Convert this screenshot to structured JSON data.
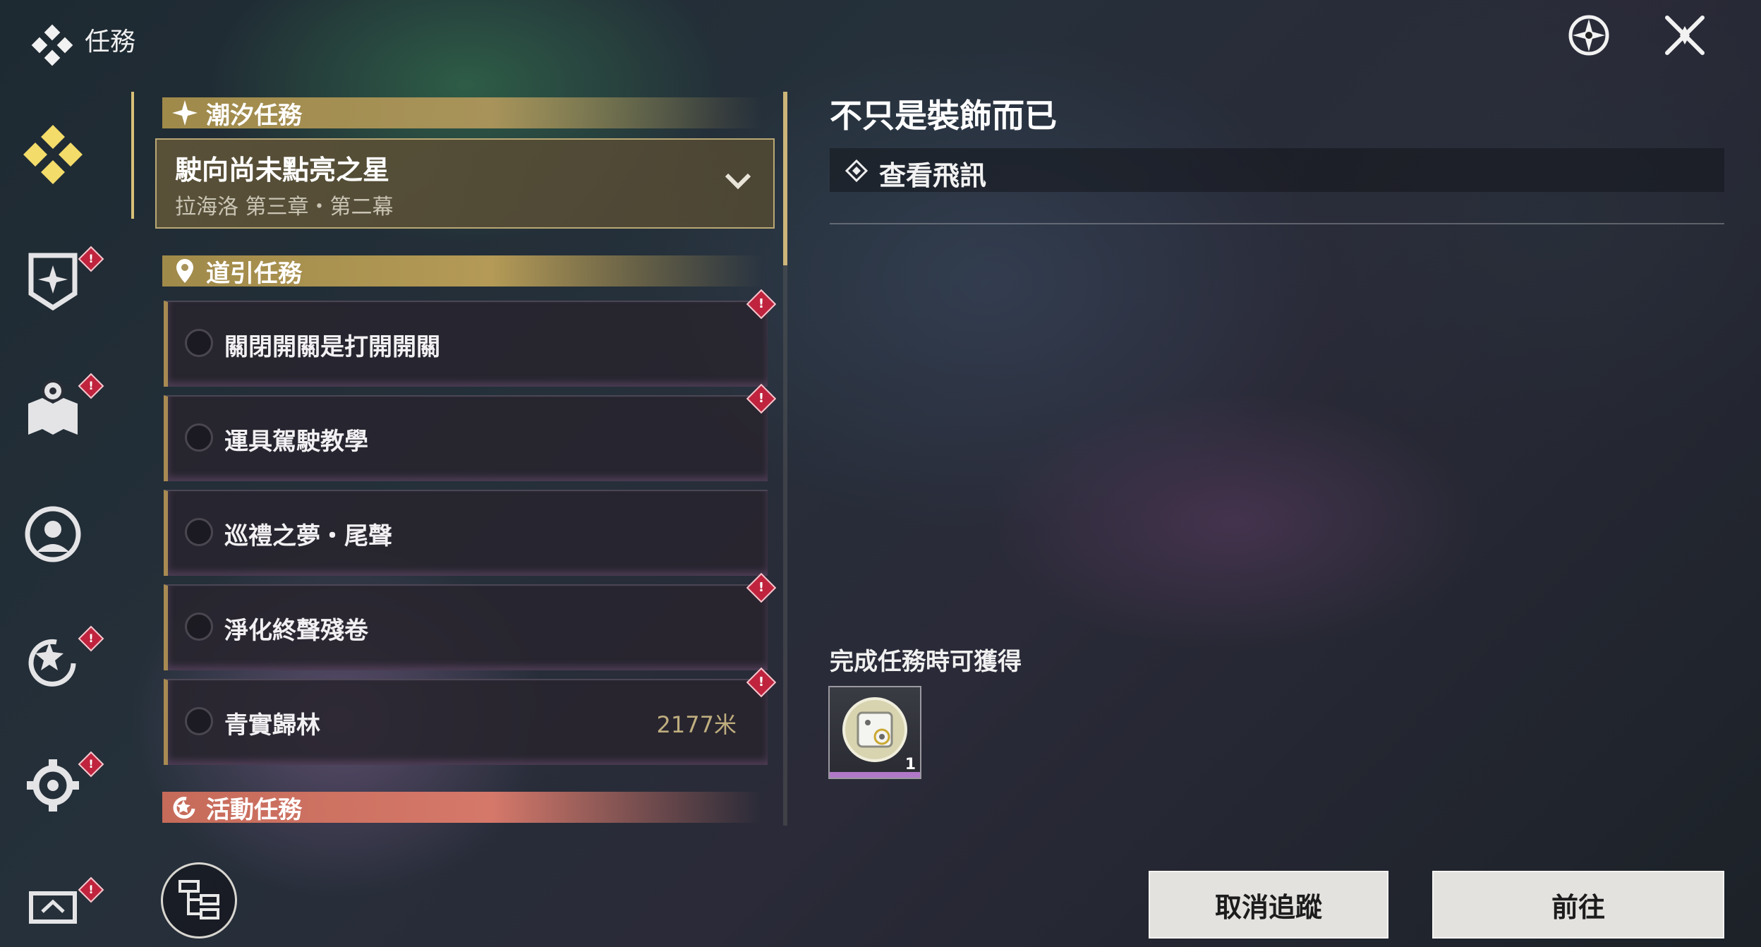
{
  "header": {
    "title": "任務"
  },
  "sections": {
    "tide": {
      "label": "潮汐任務"
    },
    "guide": {
      "label": "道引任務"
    },
    "event": {
      "label": "活動任務"
    }
  },
  "main_quest": {
    "title": "駛向尚未點亮之星",
    "subtitle": "拉海洛 第三章・第二幕"
  },
  "guide_quests": [
    {
      "name": "關閉開關是打開開關",
      "distance": "",
      "alert": true
    },
    {
      "name": "運具駕駛教學",
      "distance": "",
      "alert": true
    },
    {
      "name": "巡禮之夢・尾聲",
      "distance": "",
      "alert": false
    },
    {
      "name": "淨化終聲殘卷",
      "distance": "",
      "alert": true
    },
    {
      "name": "青實歸林",
      "distance": "2177米",
      "alert": true
    }
  ],
  "nav_icons": [
    "quest-diamond-icon",
    "shield-badge-icon",
    "map-pin-icon",
    "person-circle-icon",
    "star-refresh-icon",
    "gear-icon",
    "monitor-icon"
  ],
  "detail": {
    "title": "不只是裝飾而已",
    "objective": "查看飛訊",
    "reward_label": "完成任務時可獲得",
    "reward_qty": "1"
  },
  "buttons": {
    "cancel": "取消追蹤",
    "go": "前往"
  },
  "badge_mark": "!",
  "colors": {
    "accent_gold": "#cdb57a",
    "alert_red": "#c0233d",
    "event_orange": "#d5786a"
  }
}
